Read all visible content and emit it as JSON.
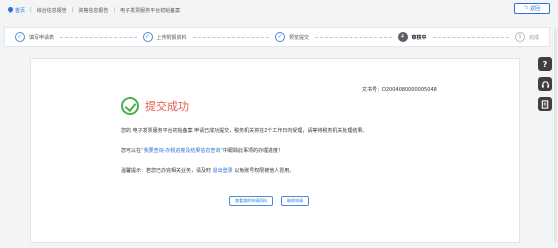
{
  "breadcrumb": {
    "home": "首页",
    "items": [
      "综合信息报告",
      "资格信息报告",
      "电子发票服务平台初始备案"
    ]
  },
  "back_button": "返回",
  "steps": [
    {
      "label": "填写申请表",
      "marker": "✓",
      "state": "done"
    },
    {
      "label": "上传附报资料",
      "marker": "✓",
      "state": "done"
    },
    {
      "label": "预览提交",
      "marker": "✓",
      "state": "done"
    },
    {
      "label": "审核中",
      "marker": "4",
      "state": "current"
    },
    {
      "label": "完成",
      "marker": "5",
      "state": "pending"
    }
  ],
  "result": {
    "doc_no": "文书号：D2004080000005048",
    "title": "提交成功",
    "line1": "您的 电子发票服务平台初始备案 申请已成功提交，税务机关将在2个工作日内受理，请等待税务机关处理结果。",
    "line2_pre": "您可以在",
    "line2_link": "“我要查询-办税进度及结果信息查询”",
    "line2_post": "中跟踪此事项的办理进度！",
    "line3_pre": "温馨提示：若您已办完相关业务，请及时",
    "line3_link": "退出登录",
    "line3_post": "以免账号权限被他人冒用。",
    "button_view": "查看我的申请资料",
    "button_continue": "继续申请"
  },
  "side_tools": [
    "?",
    "headset",
    "doc"
  ]
}
